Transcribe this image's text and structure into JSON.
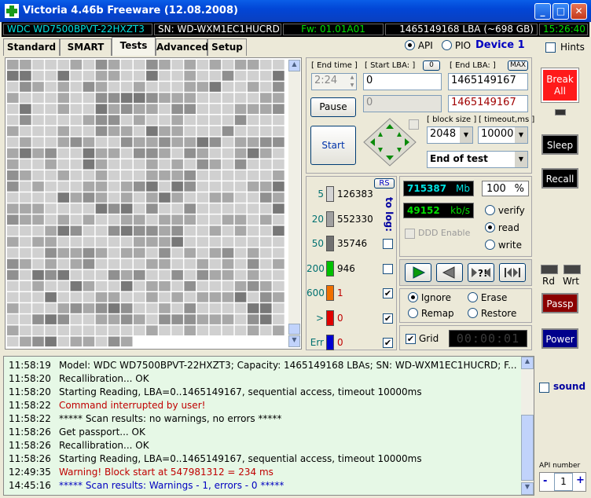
{
  "window": {
    "title": "Victoria 4.46b Freeware (12.08.2008)"
  },
  "info": {
    "model": "WDC WD7500BPVT-22HXZT3",
    "serial": "SN: WD-WXM1EC1HUCRD",
    "firmware": "Fw: 01.01A01",
    "capacity": "1465149168 LBA (~698 GB)",
    "clock": "15:26:40"
  },
  "tabs": [
    "Standard",
    "SMART",
    "Tests",
    "Advanced",
    "Setup"
  ],
  "active_tab": "Tests",
  "api": {
    "api_label": "API",
    "pio_label": "PIO",
    "device": "Device 1",
    "hints_label": "Hints"
  },
  "controls": {
    "end_time_label": "[ End time ]",
    "end_time_value": "2:24",
    "start_lba_label": "[ Start LBA: ]",
    "start_lba_value": "0",
    "start_lba_reset": "0",
    "end_lba_label": "[ End LBA: ]",
    "end_lba_max": "MAX",
    "end_lba_value": "1465149167",
    "current_lba": "0",
    "end_lba_value2": "1465149167",
    "pause_label": "Pause",
    "start_label": "Start",
    "block_size_label": "[ block size ]",
    "block_size_value": "2048",
    "timeout_label": "[ timeout,ms ]",
    "timeout_value": "10000",
    "end_action": "End of test"
  },
  "stats": {
    "rs_label": "RS",
    "to_log_label": "to log:",
    "rows": [
      {
        "threshold": "5",
        "count": "126383",
        "color": "#d4d4d4",
        "checked": ""
      },
      {
        "threshold": "20",
        "count": "552330",
        "color": "#a0a0a0",
        "checked": ""
      },
      {
        "threshold": "50",
        "count": "35746",
        "color": "#707070",
        "checked": ""
      },
      {
        "threshold": "200",
        "count": "946",
        "color": "#00c000",
        "checked": ""
      },
      {
        "threshold": "600",
        "count": "1",
        "color": "#f07000",
        "checked": "✔"
      },
      {
        "threshold": ">",
        "count": "0",
        "color": "#e00000",
        "checked": "✔"
      },
      {
        "threshold": "Err",
        "count": "0",
        "color": "#0000d0",
        "checked": "✔"
      }
    ]
  },
  "progress": {
    "mb_value": "715387",
    "mb_unit": "Mb",
    "percent_value": "100",
    "percent_unit": "%",
    "speed_value": "49152",
    "speed_unit": "kb/s",
    "ddd_label": "DDD Enable",
    "verify_label": "verify",
    "read_label": "read",
    "write_label": "write",
    "ignore_label": "Ignore",
    "erase_label": "Erase",
    "remap_label": "Remap",
    "restore_label": "Restore",
    "grid_label": "Grid",
    "elapsed": "00:00:01"
  },
  "side": {
    "break_label": "Break All",
    "sleep_label": "Sleep",
    "recall_label": "Recall",
    "rd_label": "Rd",
    "wrt_label": "Wrt",
    "passp_label": "Passp",
    "power_label": "Power",
    "sound_label": "sound",
    "api_number_label": "API number",
    "api_number_value": "1"
  },
  "log": [
    {
      "time": "11:58:19",
      "msg": "Model: WDC WD7500BPVT-22HXZT3; Capacity: 1465149168 LBAs; SN: WD-WXM1EC1HUCRD; F...",
      "color": "#000000"
    },
    {
      "time": "11:58:20",
      "msg": "Recallibration... OK",
      "color": "#000000"
    },
    {
      "time": "11:58:20",
      "msg": "Starting Reading, LBA=0..1465149167, sequential access, timeout 10000ms",
      "color": "#000000"
    },
    {
      "time": "11:58:22",
      "msg": "Command interrupted by user!",
      "color": "#c00000"
    },
    {
      "time": "11:58:22",
      "msg": "***** Scan results: no warnings, no errors *****",
      "color": "#000000"
    },
    {
      "time": "11:58:26",
      "msg": "Get passport... OK",
      "color": "#000000"
    },
    {
      "time": "11:58:26",
      "msg": "Recallibration... OK",
      "color": "#000000"
    },
    {
      "time": "11:58:26",
      "msg": "Starting Reading, LBA=0..1465149167, sequential access, timeout 10000ms",
      "color": "#000000"
    },
    {
      "time": "12:49:35",
      "msg": "Warning! Block start at 547981312 = 234 ms",
      "color": "#c00000"
    },
    {
      "time": "14:45:16",
      "msg": "***** Scan results: Warnings - 1, errors - 0 *****",
      "color": "#0000c0"
    }
  ]
}
